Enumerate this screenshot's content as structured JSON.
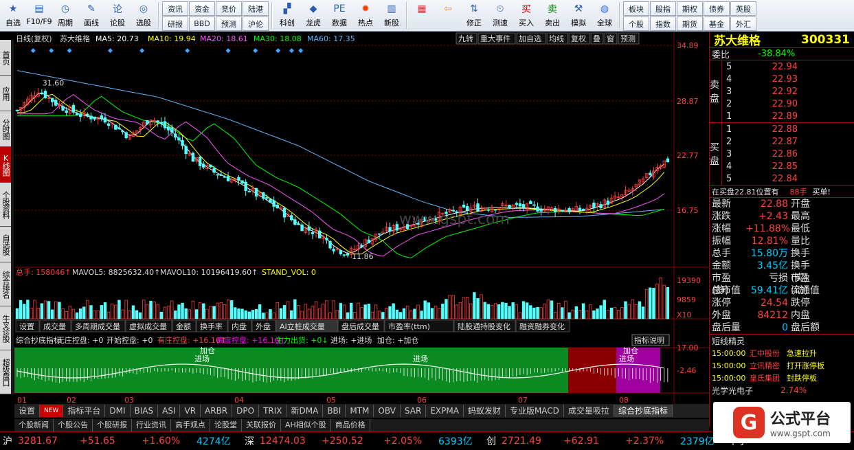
{
  "toolbar": {
    "big": [
      {
        "name": "zixuan-button",
        "label": "自选",
        "icon": "star-icon"
      },
      {
        "name": "f10-button",
        "label": "F10/F9",
        "icon": "document-icon"
      },
      {
        "name": "period-button",
        "label": "周期",
        "icon": "clock-icon"
      },
      {
        "name": "draw-button",
        "label": "画线",
        "icon": "pencil-icon"
      },
      {
        "name": "lungu-button",
        "label": "论股",
        "icon": "discuss-icon"
      },
      {
        "name": "select-stock-button",
        "label": "选股",
        "icon": "magnifier-chart-icon"
      }
    ],
    "grid": [
      [
        "资讯",
        "研报"
      ],
      [
        "资金",
        "BBD"
      ],
      [
        "竞价",
        "预测"
      ],
      [
        "陆港",
        "沪伦"
      ]
    ],
    "big2": [
      {
        "name": "kechuang-button",
        "label": "科创",
        "icon": "chart-icon"
      },
      {
        "name": "longhu-button",
        "label": "龙虎",
        "icon": "tiger-icon"
      },
      {
        "name": "data-button",
        "label": "数据",
        "icon": "pe-icon"
      },
      {
        "name": "hot-button",
        "label": "热点",
        "icon": "hot-icon"
      },
      {
        "name": "newstock-button",
        "label": "新股",
        "icon": "ipo-icon"
      }
    ],
    "tools": [
      {
        "name": "layout-button",
        "label": "",
        "icon": "grid-color-icon"
      },
      {
        "name": "back-button",
        "label": "",
        "icon": "arrow-left-icon"
      },
      {
        "name": "fix-button",
        "label": "修正",
        "icon": "up-down-icon"
      },
      {
        "name": "test-button",
        "label": "测速",
        "icon": "timer-icon"
      },
      {
        "name": "buy-button",
        "label": "买入",
        "icon": "buy-icon"
      },
      {
        "name": "sell-button",
        "label": "卖出",
        "icon": "sell-icon"
      },
      {
        "name": "simulate-button",
        "label": "模拟",
        "icon": "gavel-icon"
      },
      {
        "name": "global-button",
        "label": "全球",
        "icon": "globe-icon"
      }
    ],
    "grid2": [
      [
        "板块",
        "个股"
      ],
      [
        "股指",
        "指数"
      ],
      [
        "期权",
        "期货"
      ],
      [
        "债券",
        "基金"
      ],
      [
        "英股",
        "外汇"
      ]
    ]
  },
  "sidebar": [
    "首页",
    "应用",
    "分时图",
    "K线图",
    "个股资料",
    "自选股",
    "综合排名",
    "牛叉诊股",
    "超级盘口"
  ],
  "chart": {
    "header": {
      "period": "日线(复权)",
      "name": "苏大维格",
      "ma5": "MA5: 20.73",
      "ma10": "MA10: 19.94",
      "ma20": "MA20: 18.61",
      "ma30": "MA30: 18.08",
      "ma60": "MA60: 17.35"
    },
    "topbtns": [
      "九转",
      "重大事件",
      "加自选",
      "均线",
      "复权",
      "叠",
      "窗",
      "预测"
    ],
    "yticks": [
      "34.89",
      "28.87",
      "22.77",
      "16.75"
    ],
    "high_label": "31.60",
    "low_label": "11.86",
    "watermark": "www.gspt.com",
    "vol_header": {
      "total": "总手: 158046↑",
      "mavol5": "MAVOL5: 8825632.40↑",
      "mavol10": "MAVOL10: 10196419.60↑",
      "stand": "STAND_VOL: 0"
    },
    "vol_ticks": [
      "19390",
      "9859",
      "X10"
    ],
    "subtabs": [
      "设置",
      "成交量",
      "多周期成交量",
      "虚拟成交量",
      "金额",
      "换手率",
      "内盘",
      "外盘",
      "AI立桩成交量",
      "盘后成交量",
      "市盈率(ttm)",
      "陆股通持股变化",
      "融资融券变化"
    ],
    "ind_header": {
      "name": "综合抄底指标",
      "a": "无庄控盘: +0",
      "b": "开始控盘: +0",
      "c": "有庄控盘: +16.16↑",
      "d": "高度控盘: +16.16↑",
      "e": "主力出货: +0↓",
      "f": "进场: +进场",
      "g": "加仓: +加仓"
    },
    "ind_btn": "指标说明",
    "ind_ticks": [
      "17.00",
      "-2.46"
    ],
    "ind_labels": [
      "加仓",
      "进场",
      "进场",
      "加仓",
      "进场"
    ],
    "months": [
      "01",
      "02",
      "03",
      "04",
      "05",
      "06",
      "07",
      "08"
    ]
  },
  "chart_data": {
    "type": "candlestick",
    "title": "苏大维格",
    "ylim": [
      11.0,
      36.0
    ],
    "x": [
      "01",
      "02",
      "03",
      "04",
      "05",
      "06",
      "07",
      "08"
    ],
    "close_path": [
      [
        0,
        28.5
      ],
      [
        6,
        30.8
      ],
      [
        12,
        29.0
      ],
      [
        18,
        28.0
      ],
      [
        25,
        27.5
      ],
      [
        32,
        25.5
      ],
      [
        38,
        27.7
      ],
      [
        44,
        26.0
      ],
      [
        50,
        23.0
      ],
      [
        56,
        21.5
      ],
      [
        62,
        20.5
      ],
      [
        68,
        19.0
      ],
      [
        74,
        17.5
      ],
      [
        80,
        15.5
      ],
      [
        86,
        14.5
      ],
      [
        90,
        13.0
      ],
      [
        94,
        12.3
      ],
      [
        98,
        13.4
      ],
      [
        104,
        14.8
      ],
      [
        112,
        15.7
      ],
      [
        118,
        16.4
      ],
      [
        124,
        17.0
      ],
      [
        130,
        17.5
      ],
      [
        140,
        17.7
      ],
      [
        150,
        17.4
      ],
      [
        160,
        17.2
      ],
      [
        166,
        17.9
      ],
      [
        172,
        18.8
      ],
      [
        178,
        20.5
      ],
      [
        182,
        22.3
      ],
      [
        185,
        22.88
      ]
    ],
    "ma60_path": [
      [
        0,
        33.0
      ],
      [
        20,
        31.5
      ],
      [
        40,
        30.0
      ],
      [
        60,
        27.5
      ],
      [
        80,
        24.5
      ],
      [
        100,
        20.5
      ],
      [
        115,
        18.2
      ],
      [
        125,
        17.0
      ],
      [
        140,
        16.4
      ],
      [
        160,
        16.5
      ],
      [
        175,
        17.0
      ],
      [
        185,
        17.35
      ]
    ],
    "volume_peak": 19390
  },
  "quote": {
    "name": "苏大维格",
    "code": "300331",
    "weibi_label": "委比",
    "weibi": "-38.84%",
    "sell": [
      [
        "5",
        "22.94"
      ],
      [
        "4",
        "22.93"
      ],
      [
        "3",
        "22.92"
      ],
      [
        "2",
        "22.90"
      ],
      [
        "1",
        "22.89"
      ]
    ],
    "buy": [
      [
        "1",
        "22.88"
      ],
      [
        "2",
        "22.87"
      ],
      [
        "3",
        "22.86"
      ],
      [
        "4",
        "22.85"
      ],
      [
        "5",
        "22.84"
      ]
    ],
    "sell_label": "卖盘",
    "buy_label": "买盘",
    "inbuy": "在买盘22.81位置有",
    "inbuy_qty": "88手",
    "inbuy_act": "买单!",
    "stats": [
      [
        "最新",
        "22.88",
        "开盘",
        ""
      ],
      [
        "涨跌",
        "+2.43",
        "最高",
        ""
      ],
      [
        "涨幅",
        "+11.88%",
        "最低",
        ""
      ],
      [
        "振幅",
        "12.81%",
        "量比",
        ""
      ],
      [
        "总手",
        "15.80万",
        "换手",
        ""
      ],
      [
        "金额",
        "3.45亿",
        "换手(实)",
        ""
      ],
      [
        "市盈(静)",
        "亏损",
        "市盈(动)",
        ""
      ],
      [
        "总市值",
        "59.41亿",
        "流通值",
        ""
      ],
      [
        "涨停",
        "24.54",
        "跌停",
        ""
      ],
      [
        "外盘",
        "84212",
        "内盘",
        ""
      ],
      [
        "盘后量",
        "0",
        "盘后额",
        ""
      ]
    ],
    "news_title": "短线精灵",
    "news": [
      [
        "15:00:00",
        "汇中股份",
        "急速拉升"
      ],
      [
        "15:00:00",
        "立讯精密",
        "打开涨停板"
      ],
      [
        "15:00:00",
        "皇氏集团",
        "封跌停板"
      ]
    ],
    "ticker": [
      "光学光电子",
      "2.74%"
    ]
  },
  "bottom_tabs": [
    "设置",
    "NEW",
    "指标平台",
    "DMI",
    "BIAS",
    "ASI",
    "VR",
    "ARBR",
    "DPO",
    "TRIX",
    "新DMA",
    "BBI",
    "MTM",
    "OBV",
    "SAR",
    "EXPMA",
    "蚂蚁发财",
    "专业版MACD",
    "成交量吸拉",
    "综合抄底指标"
  ],
  "news_tabs": [
    "个股新闻",
    "个股公告",
    "个股研报",
    "行业资讯",
    "高手观点",
    "论股堂",
    "关联报价",
    "AH相似个股",
    "商品价格"
  ],
  "status": [
    {
      "k": "沪",
      "v": "3281.67",
      "c": "+51.65",
      "p": "+1.60%",
      "a": "4274亿"
    },
    {
      "k": "深",
      "v": "12474.03",
      "c": "+250.52",
      "p": "+2.05%",
      "a": "6393亿"
    },
    {
      "k": "创",
      "v": "2721.49",
      "c": "+62.91",
      "p": "+2.37%",
      "a": "2379亿"
    }
  ],
  "status_tail": "中小",
  "logo": {
    "cn": "公式平台",
    "en": "www.gspt.com"
  },
  "colors": {
    "up": "#ff3c3c",
    "down": "#54ffff",
    "ma5": "#ffffff",
    "ma10": "#ffff00",
    "ma20": "#ff55ff",
    "ma30": "#00ff00",
    "ma60": "#5fb7ff",
    "bg": "#000000",
    "grid": "#8b0000"
  }
}
